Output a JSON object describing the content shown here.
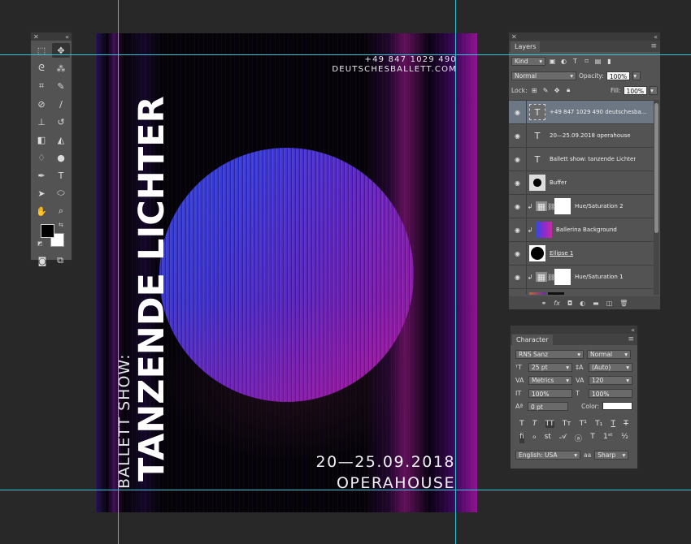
{
  "poster": {
    "title": "TANZENDE LICHTER",
    "subtitle": "BALLETT SHOW:",
    "phone": "+49 847 1029 490",
    "website": "DEUTSCHESBALLETT.COM",
    "dates": "20—25.09.2018",
    "venue": "OPERAHOUSE"
  },
  "tools": {
    "icons": [
      "marquee-icon",
      "move-icon",
      "lasso-icon",
      "magic-wand-icon",
      "crop-icon",
      "eyedropper-icon",
      "healing-brush-icon",
      "brush-icon",
      "clone-stamp-icon",
      "history-brush-icon",
      "eraser-icon",
      "paint-bucket-icon",
      "blur-icon",
      "dodge-icon",
      "pen-icon",
      "type-icon",
      "path-select-icon",
      "ellipse-icon",
      "hand-icon",
      "zoom-icon"
    ],
    "foreground_color": "#000000",
    "background_color": "#ffffff"
  },
  "layers": {
    "tab": "Layers",
    "filter_kind": "Kind",
    "blend_mode": "Normal",
    "opacity_label": "Opacity:",
    "opacity": "100%",
    "lock_label": "Lock:",
    "fill_label": "Fill:",
    "fill": "100%",
    "items": [
      {
        "name": "+49 847 1029 490 deutschesba...",
        "type": "text",
        "selected": true
      },
      {
        "name": "20—25.09.2018 operahouse",
        "type": "text",
        "selected": false
      },
      {
        "name": "Ballett show: tanzende Lichter",
        "type": "text",
        "selected": false
      },
      {
        "name": "Buffer",
        "type": "smart",
        "selected": false
      },
      {
        "name": "Hue/Saturation 2",
        "type": "adjustment",
        "selected": false
      },
      {
        "name": "Ballerina Background",
        "type": "image",
        "selected": false
      },
      {
        "name": "Ellipse 1",
        "type": "shape",
        "selected": false
      },
      {
        "name": "Hue/Saturation 1",
        "type": "adjustment",
        "selected": false
      },
      {
        "name": "",
        "type": "image",
        "selected": false
      }
    ]
  },
  "character": {
    "tab": "Character",
    "font_family": "RNS Sanz",
    "font_style": "Normal",
    "font_size": "25 pt",
    "leading": "(Auto)",
    "kerning": "Metrics",
    "tracking": "120",
    "vertical_scale": "100%",
    "horizontal_scale": "100%",
    "baseline_shift": "0 pt",
    "color_label": "Color:",
    "color": "#ffffff",
    "language": "English: USA",
    "antialias": "Sharp",
    "aa_label": "aa"
  }
}
